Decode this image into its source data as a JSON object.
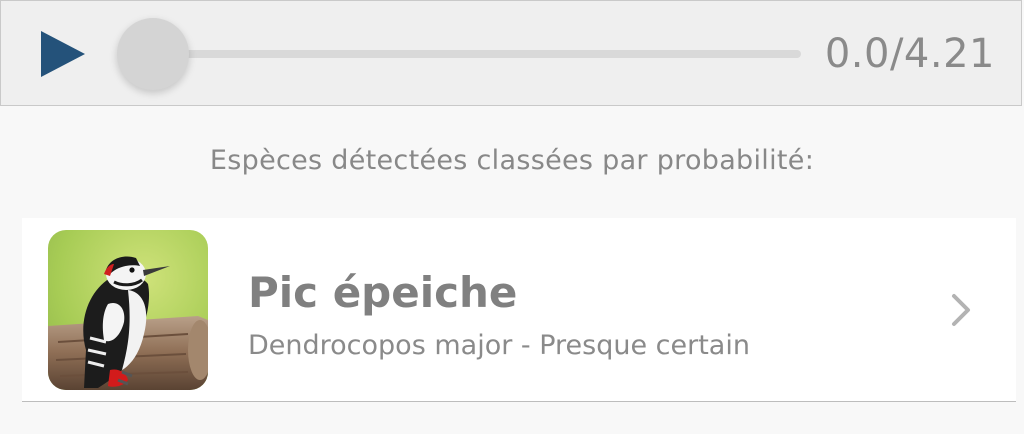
{
  "player": {
    "time_display": "0.0/4.21",
    "progress": 0.0,
    "play_icon": "play-icon",
    "accent_color": "#24527a"
  },
  "results": {
    "caption": "Espèces détectées classées par probabilité:",
    "items": [
      {
        "common_name": "Pic épeiche",
        "subtitle": "Dendrocopos major - Presque certain",
        "thumbnail": "great-spotted-woodpecker-photo",
        "chevron_icon": "chevron-right-icon"
      }
    ]
  }
}
